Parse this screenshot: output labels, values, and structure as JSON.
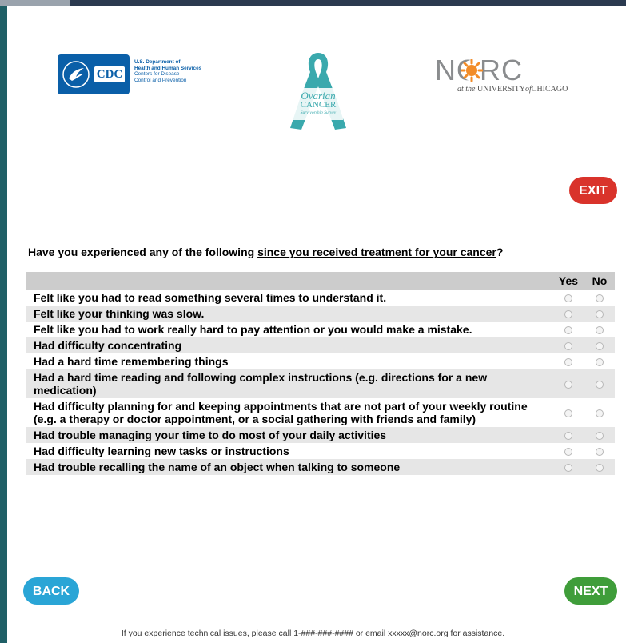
{
  "logos": {
    "cdc": {
      "badge": "CDC",
      "lines": [
        "U.S. Department of",
        "Health and Human Services",
        "Centers for Disease",
        "Control and Prevention"
      ]
    },
    "ribbon": {
      "line1": "Ovarian",
      "line2": "CANCER",
      "line3": "Survivorship Survey"
    },
    "norc": {
      "word": "NORC",
      "sub_prefix": "at the",
      "sub_main": "UNIVERSITY",
      "sub_of": "of",
      "sub_city": "CHICAGO"
    }
  },
  "buttons": {
    "exit": "EXIT",
    "back": "BACK",
    "next": "NEXT"
  },
  "question": {
    "before": "Have you experienced any of the following ",
    "underlined": "since you received treatment for your cancer",
    "after": "?"
  },
  "grid": {
    "columns": [
      "Yes",
      "No"
    ],
    "rows": [
      "Felt like you had to read something several times to understand it.",
      "Felt like your thinking was slow.",
      "Felt like you had to work really hard to pay attention or you would make a mistake.",
      "Had difficulty concentrating",
      "Had a hard time remembering things",
      "Had a hard time reading and following complex instructions (e.g. directions for a new medication)",
      "Had difficulty planning for and keeping appointments that are not part of your weekly routine (e.g. a therapy or doctor appointment, or a social gathering with friends and family)",
      "Had trouble managing your time to do most of your daily activities",
      "Had difficulty learning new tasks or instructions",
      "Had trouble recalling the name of an object when talking to someone"
    ]
  },
  "footer": {
    "before": "If you experience technical issues, please call 1-###-###-#### or email ",
    "email": "xxxxx@norc.org",
    "after": " for assistance."
  },
  "colors": {
    "exit": "#d9332b",
    "back": "#2aa5d6",
    "next": "#3f9d3a",
    "header_row": "#cccccc",
    "alt_row": "#e6e6e6"
  }
}
